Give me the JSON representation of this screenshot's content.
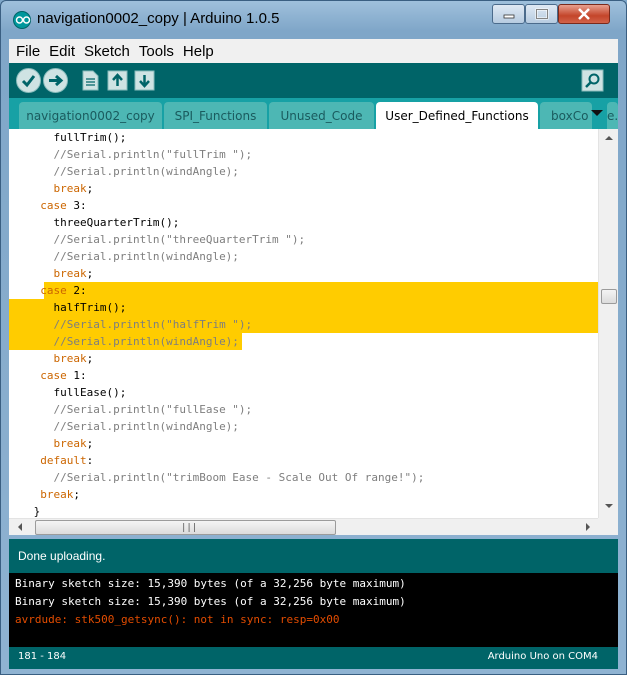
{
  "window": {
    "title": "navigation0002_copy | Arduino 1.0.5"
  },
  "menu": [
    "File",
    "Edit",
    "Sketch",
    "Tools",
    "Help"
  ],
  "toolbar": {
    "buttons": [
      "verify",
      "upload",
      "new",
      "open",
      "save"
    ],
    "serial_monitor": "serial-monitor"
  },
  "tabs": [
    {
      "label": "navigation0002_copy",
      "active": false
    },
    {
      "label": "SPI_Functions",
      "active": false
    },
    {
      "label": "Unused_Code",
      "active": false
    },
    {
      "label": "User_Defined_Functions",
      "active": true
    },
    {
      "label": "boxCo",
      "active": false
    }
  ],
  "tab_overflow_label": "e.h",
  "code_lines": [
    "    fullTrim();",
    "    //Serial.println(\"fullTrim \");",
    "    //Serial.println(windAngle);",
    "    break;",
    "  case 3:",
    "    threeQuarterTrim();",
    "    //Serial.println(\"threeQuarterTrim \");",
    "    //Serial.println(windAngle);",
    "    break;",
    "  case 2:",
    "    halfTrim();",
    "    //Serial.println(\"halfTrim \");",
    "    //Serial.println(windAngle);",
    "    break;",
    "  case 1:",
    "    fullEase();",
    "    //Serial.println(\"fullEase \");",
    "    //Serial.println(windAngle);",
    "    break;",
    "  default:",
    "    //Serial.println(\"trimBoom Ease - Scale Out Of range!\");",
    "  break;",
    " }",
    "}"
  ],
  "status": {
    "message": "Done uploading."
  },
  "console": [
    {
      "text": "Binary sketch size: 15,390 bytes (of a 32,256 byte maximum)",
      "error": false
    },
    {
      "text": "Binary sketch size: 15,390 bytes (of a 32,256 byte maximum)",
      "error": false
    },
    {
      "text": "avrdude: stk500_getsync(): not in sync: resp=0x00",
      "error": true
    }
  ],
  "footer": {
    "line_range": "181 - 184",
    "board": "Arduino Uno on COM4"
  },
  "colors": {
    "teal_dark": "#006468",
    "teal": "#17a1a5",
    "highlight": "#ffcc00",
    "keyword": "#cc6600",
    "comment": "#7e7e7e",
    "error": "#e34c00"
  }
}
